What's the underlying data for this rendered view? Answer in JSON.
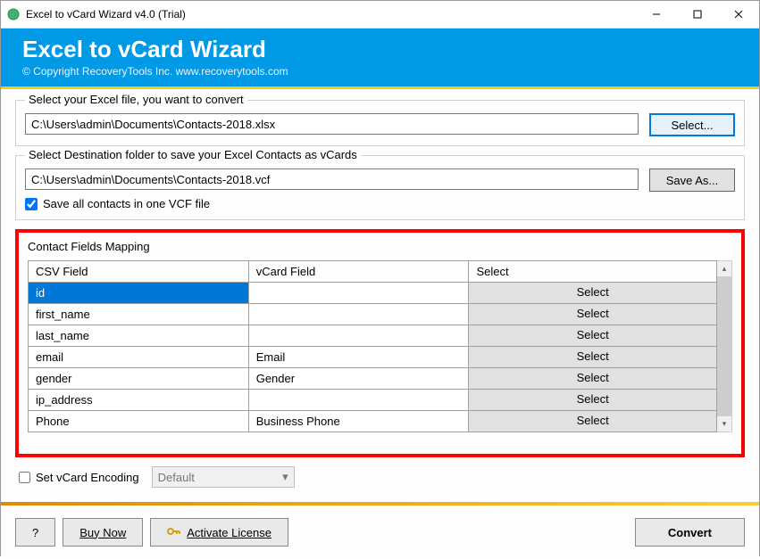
{
  "window": {
    "title": "Excel to vCard Wizard v4.0 (Trial)"
  },
  "header": {
    "title": "Excel to vCard Wizard",
    "copyright": "© Copyright RecoveryTools Inc. www.recoverytools.com"
  },
  "source": {
    "legend": "Select your Excel file, you want to convert",
    "path": "C:\\Users\\admin\\Documents\\Contacts-2018.xlsx",
    "button": "Select..."
  },
  "destination": {
    "legend": "Select Destination folder to save your Excel Contacts as vCards",
    "path": "C:\\Users\\admin\\Documents\\Contacts-2018.vcf",
    "button": "Save As...",
    "checkbox_label": "Save all contacts in one VCF file",
    "checkbox_checked": true
  },
  "mapping": {
    "legend": "Contact Fields Mapping",
    "columns": {
      "csv": "CSV Field",
      "vcard": "vCard Field",
      "select": "Select"
    },
    "select_button": "Select",
    "rows": [
      {
        "csv": "id",
        "vcard": "",
        "selected": true
      },
      {
        "csv": "first_name",
        "vcard": ""
      },
      {
        "csv": "last_name",
        "vcard": ""
      },
      {
        "csv": "email",
        "vcard": "Email"
      },
      {
        "csv": "gender",
        "vcard": "Gender"
      },
      {
        "csv": "ip_address",
        "vcard": ""
      },
      {
        "csv": "Phone",
        "vcard": "Business Phone"
      }
    ]
  },
  "encoding": {
    "checkbox_label": "Set vCard Encoding",
    "value": "Default"
  },
  "footer": {
    "help": "?",
    "buy": "Buy Now",
    "activate": "Activate License",
    "convert": "Convert"
  }
}
